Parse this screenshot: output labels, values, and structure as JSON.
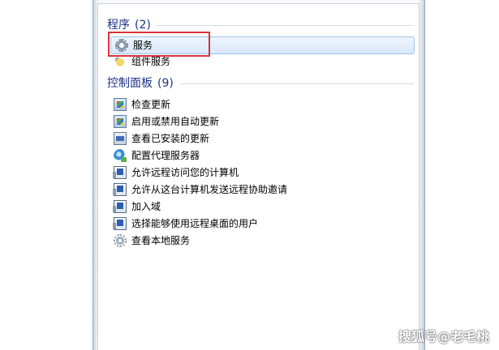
{
  "programs": {
    "header": "程序",
    "count": "(2)",
    "items": [
      {
        "label": "服务",
        "icon": "gear-icon"
      },
      {
        "label": "组件服务",
        "icon": "component-services-icon"
      }
    ]
  },
  "control_panel": {
    "header": "控制面板",
    "count": "(9)",
    "items": [
      {
        "label": "检查更新",
        "icon": "windows-update-icon"
      },
      {
        "label": "启用或禁用自动更新",
        "icon": "windows-update-icon"
      },
      {
        "label": "查看已安装的更新",
        "icon": "installed-updates-icon"
      },
      {
        "label": "配置代理服务器",
        "icon": "proxy-globe-icon"
      },
      {
        "label": "允许远程访问您的计算机",
        "icon": "remote-desktop-icon"
      },
      {
        "label": "允许从这台计算机发送远程协助邀请",
        "icon": "remote-desktop-icon"
      },
      {
        "label": "加入域",
        "icon": "remote-desktop-icon"
      },
      {
        "label": "选择能够使用远程桌面的用户",
        "icon": "remote-desktop-icon"
      },
      {
        "label": "查看本地服务",
        "icon": "local-services-icon"
      }
    ]
  },
  "watermark": "搜狐号@老毛桃",
  "colors": {
    "header_text": "#1e3287",
    "selection_bg": "#d9e8fb",
    "selection_border": "#9fc3ec",
    "annotation_box": "#d9343a"
  }
}
